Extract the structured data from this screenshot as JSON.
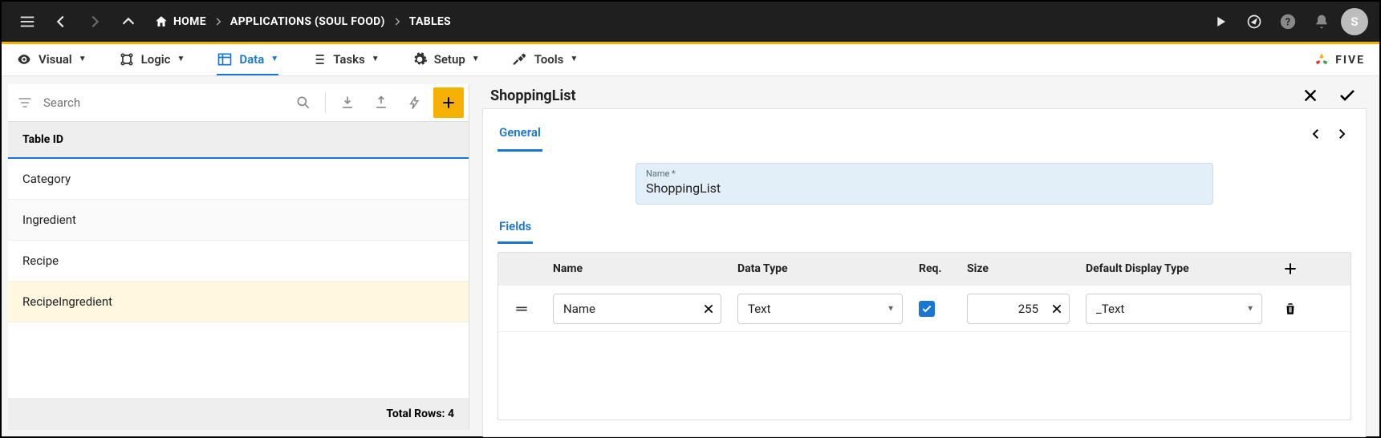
{
  "topbar": {
    "home_label": "HOME",
    "crumb1": "APPLICATIONS (SOUL FOOD)",
    "crumb2": "TABLES",
    "avatar_initial": "S"
  },
  "subnav": {
    "visual": "Visual",
    "logic": "Logic",
    "data": "Data",
    "tasks": "Tasks",
    "setup": "Setup",
    "tools": "Tools",
    "brand": "FIVE"
  },
  "left": {
    "search_placeholder": "Search",
    "header": "Table ID",
    "rows": [
      "Category",
      "Ingredient",
      "Recipe",
      "RecipeIngredient"
    ],
    "footer_label": "Total Rows:",
    "footer_count": "4"
  },
  "detail": {
    "title": "ShoppingList",
    "tab_general": "General",
    "name_label": "Name *",
    "name_value": "ShoppingList",
    "section_fields": "Fields",
    "grid": {
      "headers": {
        "name": "Name",
        "datatype": "Data Type",
        "req": "Req.",
        "size": "Size",
        "display": "Default Display Type"
      },
      "row": {
        "name": "Name",
        "datatype": "Text",
        "req_checked": true,
        "size": "255",
        "display": "_Text"
      }
    }
  }
}
